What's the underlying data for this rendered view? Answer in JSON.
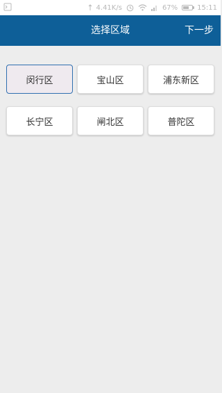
{
  "status_bar": {
    "network_speed": "4.41K/s",
    "battery_percent": "67%",
    "battery_level": 0.67,
    "time": "15:11",
    "icons": [
      "screenshot-icon",
      "speed-icon",
      "alarm-icon",
      "wifi-icon",
      "signal-icon",
      "battery-icon"
    ]
  },
  "app_bar": {
    "title": "选择区域",
    "next_label": "下一步"
  },
  "districts": [
    {
      "label": "闵行区",
      "selected": true
    },
    {
      "label": "宝山区",
      "selected": false
    },
    {
      "label": "浦东新区",
      "selected": false
    },
    {
      "label": "长宁区",
      "selected": false
    },
    {
      "label": "闸北区",
      "selected": false
    },
    {
      "label": "普陀区",
      "selected": false
    }
  ],
  "colors": {
    "app_bar": "#0e5f98",
    "background": "#ededed",
    "selected_border": "#2f6fb0",
    "selected_fill": "#efeaef"
  }
}
